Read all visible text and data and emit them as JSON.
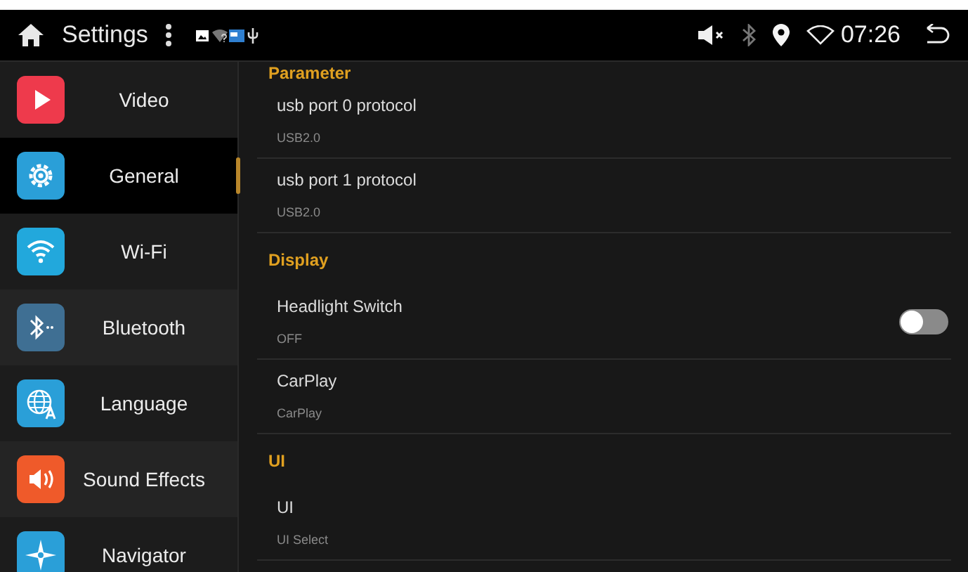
{
  "status_bar": {
    "title": "Settings",
    "time": "07:26"
  },
  "sidebar": {
    "items": [
      {
        "label": "Video",
        "color": "#ee3a4c",
        "selected": false
      },
      {
        "label": "General",
        "color": "#2a9fd8",
        "selected": true
      },
      {
        "label": "Wi-Fi",
        "color": "#22a8dc",
        "selected": false
      },
      {
        "label": "Bluetooth",
        "color": "#3f6f93",
        "selected": false
      },
      {
        "label": "Language",
        "color": "#2a9fd8",
        "selected": false
      },
      {
        "label": "Sound Effects",
        "color": "#ef5a2a",
        "selected": false
      },
      {
        "label": "Navigator",
        "color": "#2a9fd8",
        "selected": false
      }
    ]
  },
  "content": {
    "sections": [
      {
        "title": "Parameter",
        "items": [
          {
            "kind": "text",
            "title": "usb port 0 protocol",
            "summary": "USB2.0"
          },
          {
            "kind": "text",
            "title": "usb port 1 protocol",
            "summary": "USB2.0"
          }
        ]
      },
      {
        "title": "Display",
        "items": [
          {
            "kind": "switch",
            "title": "Headlight Switch",
            "summary": "OFF",
            "on": false
          },
          {
            "kind": "text",
            "title": "CarPlay",
            "summary": "CarPlay"
          }
        ]
      },
      {
        "title": "UI",
        "items": [
          {
            "kind": "text",
            "title": "UI",
            "summary": "UI Select"
          }
        ]
      }
    ]
  }
}
